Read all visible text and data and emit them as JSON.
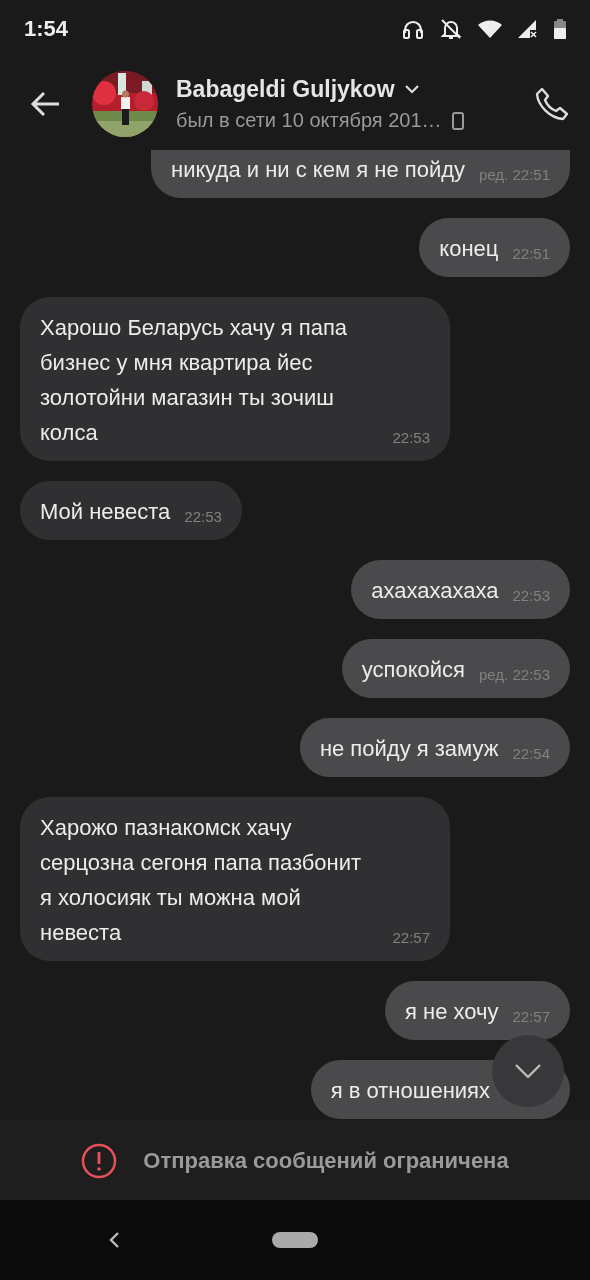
{
  "status_bar": {
    "time": "1:54"
  },
  "header": {
    "name": "Babageldi Guljykow",
    "status": "был в сети 10 октября 201…"
  },
  "messages": [
    {
      "kind": "outgoing",
      "text": "никуда и ни с кем я не пойду",
      "time": "ред. 22:51"
    },
    {
      "kind": "outgoing",
      "text": "конец",
      "time": "22:51"
    },
    {
      "kind": "incoming",
      "text": "Харошо  Беларусь хачу я папа бизнес у мня квартира йес золотойни магазин ты зочиш колса",
      "time": "22:53"
    },
    {
      "kind": "incoming",
      "text": "Мой невеста",
      "time": "22:53"
    },
    {
      "kind": "outgoing",
      "text": "ахахахахаха",
      "time": "22:53"
    },
    {
      "kind": "outgoing",
      "text": "успокойся",
      "time": "ред. 22:53"
    },
    {
      "kind": "outgoing",
      "text": "не пойду я замуж",
      "time": "22:54"
    },
    {
      "kind": "incoming",
      "text": "Харожо пазнакомск хачу серцозна сегоня папа пазбонит я холосияк ты можна мой невеста",
      "time": "22:57"
    },
    {
      "kind": "outgoing",
      "text": "я не хочу",
      "time": "22:57"
    },
    {
      "kind": "outgoing",
      "text": "я в отношениях"
    }
  ],
  "restriction": {
    "text": "Отправка сообщений ограничена"
  }
}
